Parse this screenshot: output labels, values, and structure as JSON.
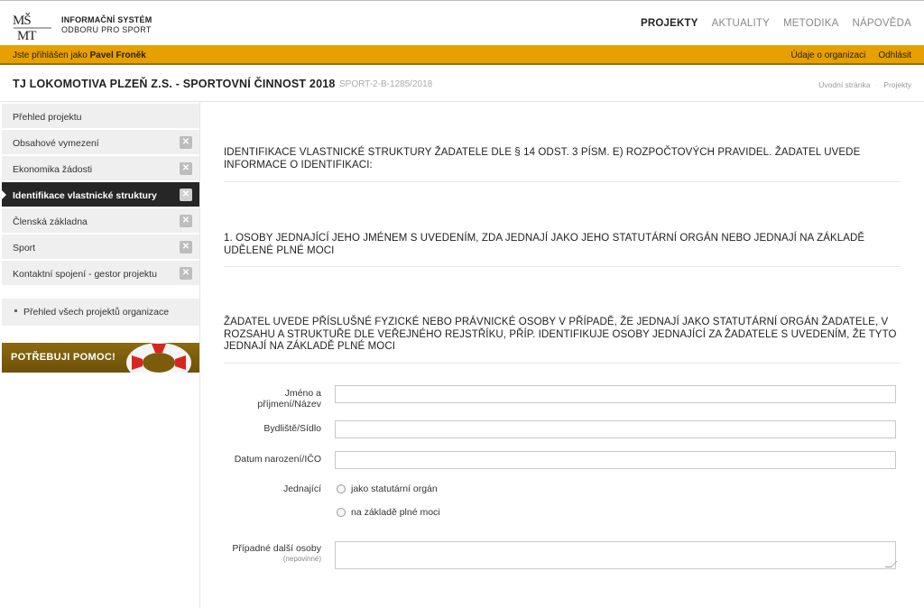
{
  "header": {
    "logo_mark": "MŠMT",
    "logo_line1": "INFORMAČNÍ SYSTÉM",
    "logo_line2": "ODBORU PRO SPORT",
    "nav": [
      "PROJEKTY",
      "AKTUALITY",
      "METODIKA",
      "NÁPOVĚDA"
    ],
    "active_nav": "PROJEKTY"
  },
  "userbar": {
    "prefix": "Jste přihlášen jako",
    "user": "Pavel Froněk",
    "links": [
      "Údaje o organizaci",
      "Odhlásit"
    ]
  },
  "titlebar": {
    "title": "TJ LOKOMOTIVA PLZEŇ Z.S. - SPORTOVNÍ ČINNOST 2018",
    "code": "SPORT-2-B-1285/2018",
    "breadcrumbs": [
      "Úvodní stránka",
      "Projekty"
    ]
  },
  "sidebar": {
    "items": [
      {
        "label": "Přehled projektu",
        "removable": false
      },
      {
        "label": "Obsahové vymezení",
        "removable": true
      },
      {
        "label": "Ekonomika žádosti",
        "removable": true
      },
      {
        "label": "Identifikace vlastnické struktury",
        "removable": true
      },
      {
        "label": "Členská základna",
        "removable": true
      },
      {
        "label": "Sport",
        "removable": true
      },
      {
        "label": "Kontaktní spojení - gestor projektu",
        "removable": true
      }
    ],
    "active_index": 3,
    "overview_link": "Přehled všech projektů organizace",
    "help_label": "POTŘEBUJI POMOC!"
  },
  "main": {
    "heading1": "IDENTIFIKACE VLASTNICKÉ STRUKTURY ŽADATELE DLE § 14 ODST. 3 PÍSM. E) ROZPOČTOVÝCH PRAVIDEL. ŽADATEL UVEDE INFORMACE O IDENTIFIKACI:",
    "heading2": "1. OSOBY JEDNAJÍCÍ JEHO JMÉNEM S UVEDENÍM, ZDA JEDNAJÍ JAKO JEHO STATUTÁRNÍ ORGÁN NEBO JEDNAJÍ NA ZÁKLADĚ UDĚLENÉ PLNÉ MOCI",
    "heading3": "ŽADATEL UVEDE PŘÍSLUŠNÉ FYZICKÉ NEBO PRÁVNICKÉ OSOBY V PŘÍPADĚ, ŽE JEDNAJÍ JAKO STATUTÁRNÍ ORGÁN ŽADATELE, V ROZSAHU A STRUKTUŘE DLE VEŘEJNÉHO REJSTŘÍKU, PŘÍP. IDENTIFIKUJE OSOBY JEDNAJÍCÍ ZA ŽADATELE S UVEDENÍM, ŽE TYTO JEDNAJÍ NA ZÁKLADĚ PLNÉ MOCI",
    "form": {
      "name_label": "Jméno a příjmení/Název",
      "name_value": "",
      "address_label": "Bydliště/Sídlo",
      "address_value": "",
      "id_label": "Datum narození/IČO",
      "id_value": "",
      "acting_label": "Jednající",
      "radio1": "jako statutární orgán",
      "radio2": "na základě plné moci",
      "others_label": "Případné další osoby",
      "others_sublabel": "(nepovinné)",
      "others_value": ""
    }
  },
  "colors": {
    "accent": "#e6a000",
    "active_bg": "#262626",
    "sidebar_bg": "#efefef"
  }
}
